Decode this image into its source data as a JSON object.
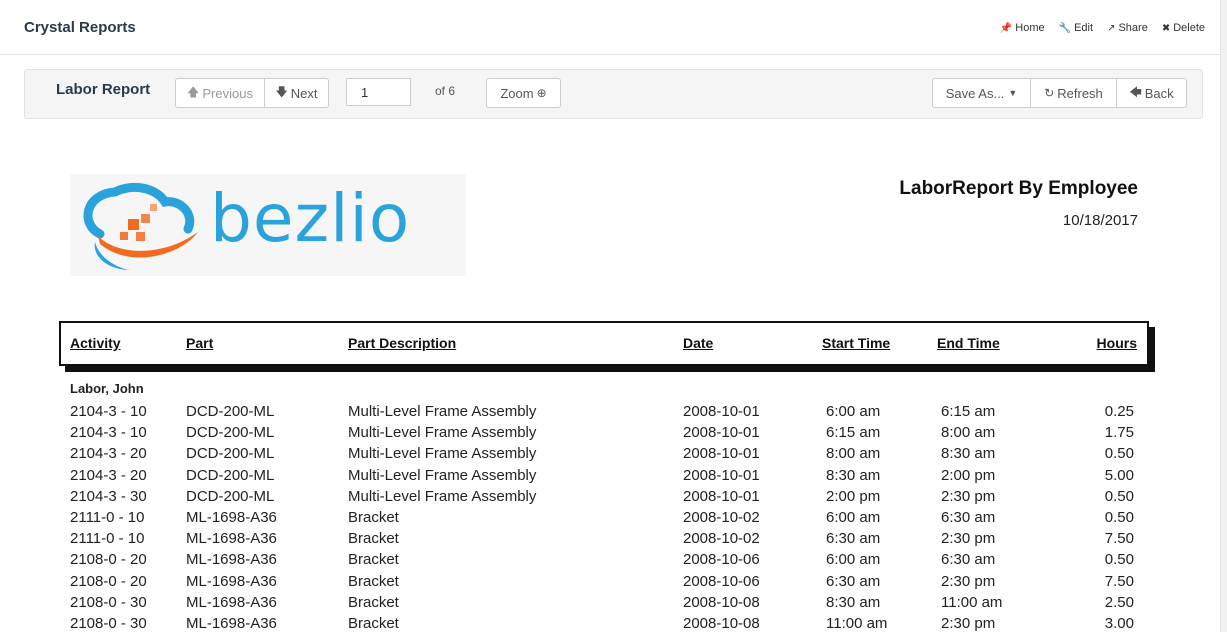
{
  "app": {
    "title": "Crystal Reports",
    "actions": [
      {
        "icon": "pin-icon",
        "glyph": "📌",
        "label": "Home"
      },
      {
        "icon": "wrench-icon",
        "glyph": "🔧",
        "label": "Edit"
      },
      {
        "icon": "share-icon",
        "glyph": "↗",
        "label": "Share"
      },
      {
        "icon": "close-icon",
        "glyph": "✖",
        "label": "Delete"
      }
    ]
  },
  "toolbar": {
    "report_name": "Labor Report",
    "previous_label": "Previous",
    "next_label": "Next",
    "page_value": "1",
    "of_label": "of 6",
    "zoom_label": "Zoom",
    "save_as_label": "Save As...",
    "refresh_label": "Refresh",
    "back_label": "Back"
  },
  "report": {
    "logo_text": "bezlio",
    "title": "LaborReport By Employee",
    "date": "10/18/2017",
    "columns": {
      "activity": "Activity",
      "part": "Part",
      "description": "Part Description",
      "date": "Date",
      "start": "Start Time",
      "end": "End Time",
      "hours": "Hours"
    },
    "group": "Labor, John",
    "rows": [
      [
        "2104-3 - 10",
        "DCD-200-ML",
        "Multi-Level Frame Assembly",
        "2008-10-01",
        "6:00 am",
        "6:15 am",
        "0.25"
      ],
      [
        "2104-3 - 10",
        "DCD-200-ML",
        "Multi-Level Frame Assembly",
        "2008-10-01",
        "6:15 am",
        "8:00 am",
        "1.75"
      ],
      [
        "2104-3 - 20",
        "DCD-200-ML",
        "Multi-Level Frame Assembly",
        "2008-10-01",
        "8:00 am",
        "8:30 am",
        "0.50"
      ],
      [
        "2104-3 - 20",
        "DCD-200-ML",
        "Multi-Level Frame Assembly",
        "2008-10-01",
        "8:30 am",
        "2:00 pm",
        "5.00"
      ],
      [
        "2104-3 - 30",
        "DCD-200-ML",
        "Multi-Level Frame Assembly",
        "2008-10-01",
        "2:00 pm",
        "2:30 pm",
        "0.50"
      ],
      [
        "2111-0 - 10",
        "ML-1698-A36",
        "Bracket",
        "2008-10-02",
        "6:00 am",
        "6:30 am",
        "0.50"
      ],
      [
        "2111-0 - 10",
        "ML-1698-A36",
        "Bracket",
        "2008-10-02",
        "6:30 am",
        "2:30 pm",
        "7.50"
      ],
      [
        "2108-0 - 20",
        "ML-1698-A36",
        "Bracket",
        "2008-10-06",
        "6:00 am",
        "6:30 am",
        "0.50"
      ],
      [
        "2108-0 - 20",
        "ML-1698-A36",
        "Bracket",
        "2008-10-06",
        "6:30 am",
        "2:30 pm",
        "7.50"
      ],
      [
        "2108-0 - 30",
        "ML-1698-A36",
        "Bracket",
        "2008-10-08",
        "8:30 am",
        "11:00 am",
        "2.50"
      ],
      [
        "2108-0 - 30",
        "ML-1698-A36",
        "Bracket",
        "2008-10-08",
        "11:00 am",
        "2:30 pm",
        "3.00"
      ]
    ]
  },
  "colors": {
    "logo_blue": "#2aa3dc",
    "logo_orange": "#f26b21"
  }
}
